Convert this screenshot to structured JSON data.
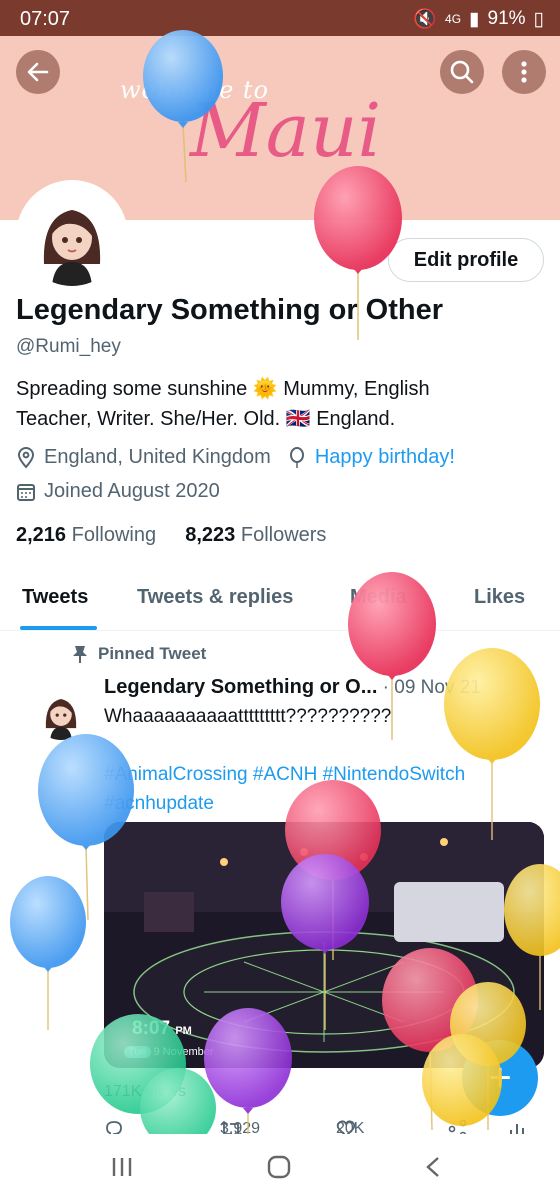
{
  "status_bar": {
    "time": "07:07",
    "battery": "91%",
    "network": "4G"
  },
  "banner": {
    "welcome_text": "welcome to",
    "title_text": "Maui"
  },
  "profile": {
    "edit_label": "Edit profile",
    "name": "Legendary Something or Other",
    "handle": "@Rumi_hey",
    "bio_line1": "Spreading some sunshine 🌞 Mummy, English",
    "bio_line2": "Teacher, Writer. She/Her. Old. 🇬🇧 England.",
    "location": "England, United Kingdom",
    "birthday": "Happy birthday!",
    "joined": "Joined August 2020",
    "following_count": "2,216",
    "following_label": "Following",
    "followers_count": "8,223",
    "followers_label": "Followers"
  },
  "tabs": [
    {
      "label": "Tweets"
    },
    {
      "label": "Tweets & replies"
    },
    {
      "label": "Media"
    },
    {
      "label": "Likes"
    }
  ],
  "tweet": {
    "pinned_label": "Pinned Tweet",
    "author": "Legendary Something or O...",
    "date": "· 09 Nov 21",
    "text": "Whaaaaaaaaaattttttttt??????????",
    "hashtags_line1": "#AnimalCrossing #ACNH #NintendoSwitch",
    "hashtags_line2": "#acnhupdate",
    "media_time": "8:07",
    "media_ampm": "PM",
    "media_day": "Tue",
    "media_date": "9 November",
    "views": "171K views",
    "retweets": "3,929",
    "likes": "20K"
  },
  "colors": {
    "accent": "#1d9bf0",
    "status_bar": "#7a3b2e",
    "banner": "#f6c9bc"
  }
}
